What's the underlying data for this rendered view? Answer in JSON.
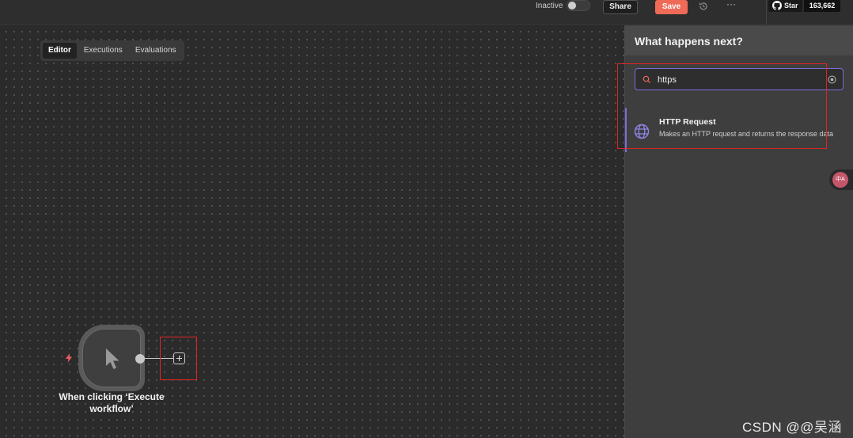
{
  "topbar": {
    "status_label": "Inactive",
    "share_label": "Share",
    "save_label": "Save",
    "more_label": "···",
    "github_star_label": "Star",
    "github_star_count": "163,662"
  },
  "tabs": [
    {
      "label": "Editor",
      "active": true
    },
    {
      "label": "Executions",
      "active": false
    },
    {
      "label": "Evaluations",
      "active": false
    }
  ],
  "node": {
    "label": "When clicking ‘Execute workflow’",
    "icon": "cursor-icon",
    "trigger_icon": "lightning-icon"
  },
  "panel": {
    "title": "What happens next?",
    "search_value": "https",
    "results": [
      {
        "title": "HTTP Request",
        "description": "Makes an HTTP request and returns the response data",
        "icon": "globe-icon"
      }
    ]
  },
  "translate_button": "中A",
  "watermark": "CSDN @@吴涵",
  "colors": {
    "accent": "#7b6cd9",
    "save": "#ef6b57",
    "highlight": "#e02424",
    "canvas": "#2b2b2b"
  }
}
